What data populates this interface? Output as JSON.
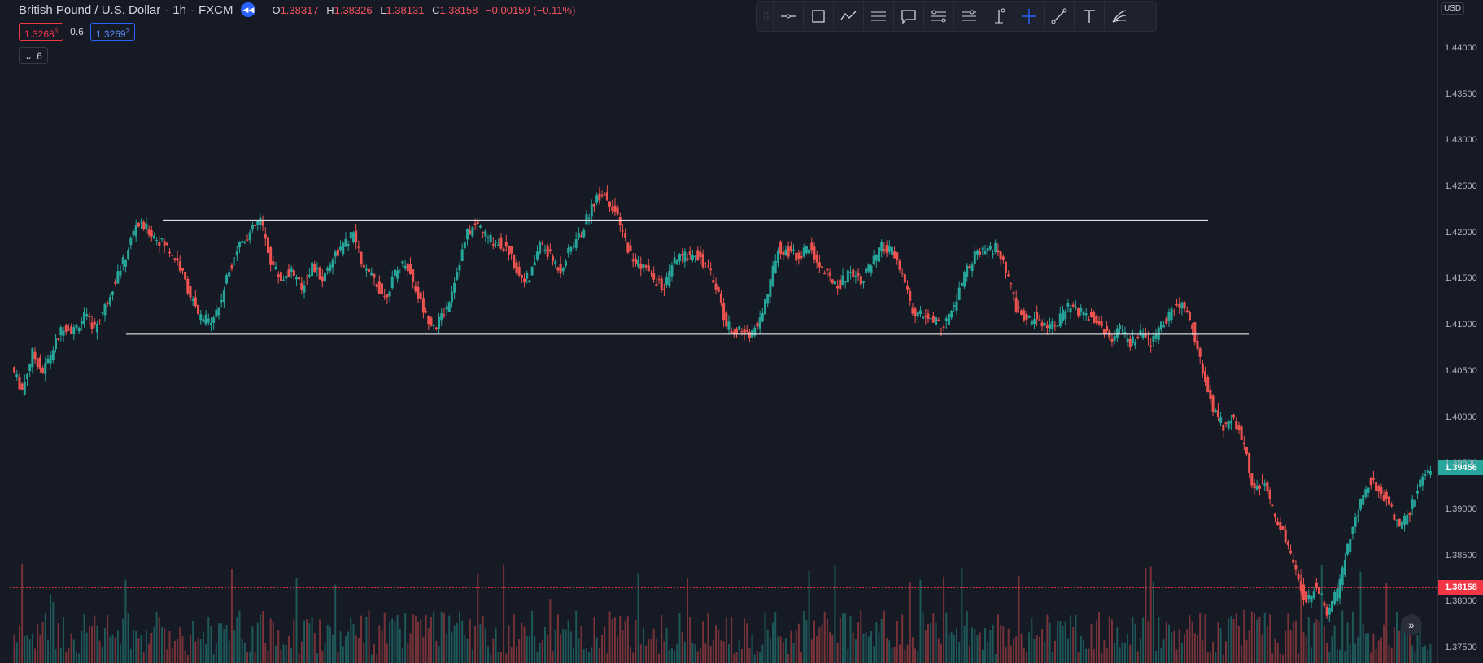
{
  "legend": {
    "title": "British Pound / U.S. Dollar",
    "interval": "1h",
    "source": "FXCM",
    "open_key": "O",
    "open": "1.38317",
    "high_key": "H",
    "high": "1.38326",
    "low_key": "L",
    "low": "1.38131",
    "close_key": "C",
    "close": "1.38158",
    "change": "−0.00159 (−0.11%)",
    "sell_price": "1.3268",
    "sell_price_small": "6",
    "spread": "0.6",
    "buy_price": "1.3269",
    "buy_price_small": "2",
    "collapse_count": "6"
  },
  "toolbar": {
    "tools": [
      "horizontal-ray-icon",
      "rectangle-icon",
      "path-icon",
      "parallel-lines-icon",
      "callout-icon",
      "position-icon",
      "range-icon",
      "vertical-ray-icon",
      "crosshair-icon",
      "trend-line-icon",
      "text-icon",
      "fib-fan-icon"
    ]
  },
  "price_axis": {
    "currency": "USD",
    "ticks": [
      "1.44000",
      "1.43500",
      "1.43000",
      "1.42500",
      "1.42000",
      "1.41500",
      "1.41000",
      "1.40500",
      "1.40000",
      "1.39500",
      "1.39000",
      "1.38500",
      "1.38000",
      "1.37500"
    ],
    "current_price": "1.39456",
    "current_color": "#26a69a",
    "last_price": "1.38158",
    "last_color": "#f23645"
  },
  "chart_data": {
    "type": "candlestick",
    "symbol": "GBPUSD",
    "ylim": [
      1.375,
      1.4415
    ],
    "support_level": 1.4091,
    "resistance_level": 1.4214,
    "series": [
      {
        "values": [
          1.4055,
          1.403,
          1.407,
          1.405,
          1.4075,
          1.41,
          1.4095,
          1.411,
          1.4098,
          1.412,
          1.415,
          1.4175,
          1.421,
          1.4205,
          1.4195,
          1.4185,
          1.417,
          1.414,
          1.411,
          1.4105,
          1.412,
          1.416,
          1.419,
          1.42,
          1.4215,
          1.417,
          1.415,
          1.416,
          1.414,
          1.4165,
          1.415,
          1.4175,
          1.4185,
          1.42,
          1.416,
          1.415,
          1.413,
          1.4155,
          1.417,
          1.414,
          1.411,
          1.41,
          1.412,
          1.416,
          1.42,
          1.421,
          1.4195,
          1.419,
          1.418,
          1.4155,
          1.415,
          1.419,
          1.4175,
          1.416,
          1.4185,
          1.42,
          1.423,
          1.4245,
          1.423,
          1.42,
          1.417,
          1.4165,
          1.415,
          1.414,
          1.417,
          1.4175,
          1.418,
          1.4165,
          1.4145,
          1.41,
          1.4095,
          1.409,
          1.41,
          1.4135,
          1.4185,
          1.418,
          1.4175,
          1.4185,
          1.4165,
          1.415,
          1.4145,
          1.416,
          1.415,
          1.4165,
          1.4185,
          1.418,
          1.4155,
          1.4115,
          1.411,
          1.4105,
          1.41,
          1.412,
          1.4155,
          1.4175,
          1.418,
          1.4185,
          1.416,
          1.412,
          1.4105,
          1.411,
          1.41,
          1.4105,
          1.412,
          1.4115,
          1.411,
          1.4105,
          1.4085,
          1.4095,
          1.408,
          1.409,
          1.408,
          1.41,
          1.4115,
          1.4125,
          1.41,
          1.405,
          1.401,
          1.399,
          1.4,
          1.397,
          1.392,
          1.393,
          1.389,
          1.387,
          1.383,
          1.38,
          1.382,
          1.379,
          1.381,
          1.386,
          1.39,
          1.393,
          1.3925,
          1.3905,
          1.388,
          1.39,
          1.393,
          1.3946
        ]
      }
    ]
  }
}
